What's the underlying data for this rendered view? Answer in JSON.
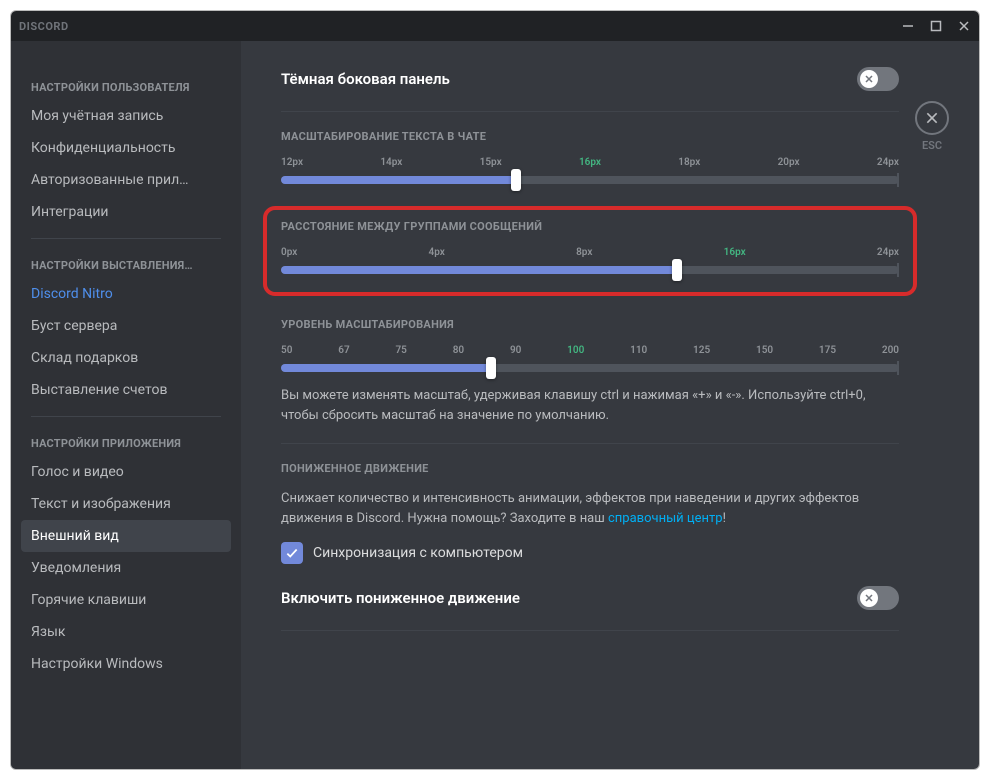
{
  "titlebar": {
    "brand": "DISCORD"
  },
  "esc": {
    "label": "ESC"
  },
  "sidebar": {
    "sections": [
      {
        "header": "НАСТРОЙКИ ПОЛЬЗОВАТЕЛЯ",
        "items": [
          {
            "label": "Моя учётная запись",
            "name": "sidebar-item-account"
          },
          {
            "label": "Конфиденциальность",
            "name": "sidebar-item-privacy"
          },
          {
            "label": "Авторизованные прил…",
            "name": "sidebar-item-apps"
          },
          {
            "label": "Интеграции",
            "name": "sidebar-item-integrations"
          }
        ]
      },
      {
        "header": "НАСТРОЙКИ ВЫСТАВЛЕНИЯ…",
        "items": [
          {
            "label": "Discord Nitro",
            "name": "sidebar-item-nitro",
            "nitro": true
          },
          {
            "label": "Буст сервера",
            "name": "sidebar-item-boost"
          },
          {
            "label": "Склад подарков",
            "name": "sidebar-item-gifts"
          },
          {
            "label": "Выставление счетов",
            "name": "sidebar-item-billing"
          }
        ]
      },
      {
        "header": "НАСТРОЙКИ ПРИЛОЖЕНИЯ",
        "items": [
          {
            "label": "Голос и видео",
            "name": "sidebar-item-voice"
          },
          {
            "label": "Текст и изображения",
            "name": "sidebar-item-text"
          },
          {
            "label": "Внешний вид",
            "name": "sidebar-item-appearance",
            "active": true
          },
          {
            "label": "Уведомления",
            "name": "sidebar-item-notifications"
          },
          {
            "label": "Горячие клавиши",
            "name": "sidebar-item-keybinds"
          },
          {
            "label": "Язык",
            "name": "sidebar-item-language"
          },
          {
            "label": "Настройки Windows",
            "name": "sidebar-item-windows"
          }
        ]
      }
    ]
  },
  "content": {
    "dark_sidebar": {
      "title": "Тёмная боковая панель",
      "enabled": false
    },
    "font_scaling": {
      "label": "МАСШТАБИРОВАНИЕ ТЕКСТА В ЧАТЕ",
      "ticks": [
        "12px",
        "14px",
        "15px",
        "16px",
        "18px",
        "20px",
        "24px"
      ],
      "current": "16px",
      "percent": 38
    },
    "group_spacing": {
      "label": "РАССТОЯНИЕ МЕЖДУ ГРУППАМИ СООБЩЕНИЙ",
      "ticks": [
        "0px",
        "4px",
        "8px",
        "16px",
        "24px"
      ],
      "current": "16px",
      "percent": 64
    },
    "zoom": {
      "label": "УРОВЕНЬ МАСШТАБИРОВАНИЯ",
      "ticks": [
        "50",
        "67",
        "75",
        "80",
        "90",
        "100",
        "110",
        "125",
        "150",
        "175",
        "200"
      ],
      "current": "100",
      "percent": 34,
      "desc": "Вы можете изменять масштаб, удерживая клавишу ctrl и нажимая «+» и «-». Используйте ctrl+0, чтобы сбросить масштаб на значение по умолчанию."
    },
    "reduced_motion": {
      "label": "ПОНИЖЕННОЕ ДВИЖЕНИЕ",
      "desc_1": "Снижает количество и интенсивность анимации, эффектов при наведении и других эффектов движения в Discord. Нужна помощь? Заходите в наш ",
      "link": "справочный центр",
      "desc_2": "!",
      "sync_label": "Синхронизация с компьютером",
      "toggle_title": "Включить пониженное движение",
      "enabled": false
    }
  }
}
